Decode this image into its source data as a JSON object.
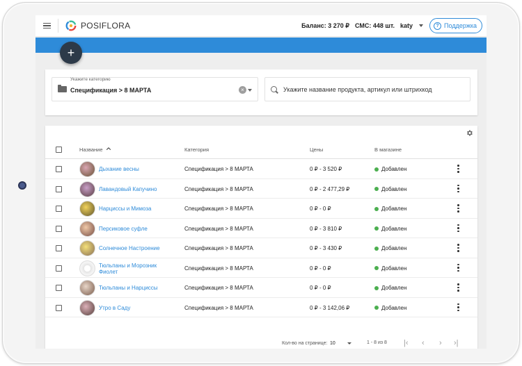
{
  "header": {
    "brand": "POSIFLORA",
    "balance": "Баланс: 3 270 ₽",
    "sms": "СМС: 448 шт.",
    "user": "katy",
    "support_label": "Поддержка"
  },
  "fab_label": "+",
  "filters": {
    "category_label": "Укажите категорию",
    "category_value": "Спецификация > 8 МАРТА",
    "search_placeholder": "Укажите название продукта, артикул или штрихкод"
  },
  "table": {
    "columns": {
      "name": "Название",
      "category": "Категория",
      "price": "Цены",
      "status": "В магазине"
    },
    "rows": [
      {
        "name": "Дыхание весны",
        "category": "Спецификация > 8 МАРТА",
        "price": "0 ₽ - 3 520 ₽",
        "status": "Добавлен"
      },
      {
        "name": "Лавандовый Капучино",
        "category": "Спецификация > 8 МАРТА",
        "price": "0 ₽ - 2 477,29 ₽",
        "status": "Добавлен"
      },
      {
        "name": "Нарциссы и Мимоза",
        "category": "Спецификация > 8 МАРТА",
        "price": "0 ₽ - 0 ₽",
        "status": "Добавлен"
      },
      {
        "name": "Персиковое суфле",
        "category": "Спецификация > 8 МАРТА",
        "price": "0 ₽ - 3 810 ₽",
        "status": "Добавлен"
      },
      {
        "name": "Солнечное Настроение",
        "category": "Спецификация > 8 МАРТА",
        "price": "0 ₽ - 3 430 ₽",
        "status": "Добавлен"
      },
      {
        "name": "Тюльпаны и Морозник Фиолет",
        "category": "Спецификация > 8 МАРТА",
        "price": "0 ₽ - 0 ₽",
        "status": "Добавлен"
      },
      {
        "name": "Тюльпаны и Нарциссы",
        "category": "Спецификация > 8 МАРТА",
        "price": "0 ₽ - 0 ₽",
        "status": "Добавлен"
      },
      {
        "name": "Утро в Саду",
        "category": "Спецификация > 8 МАРТА",
        "price": "0 ₽ - 3 142,06 ₽",
        "status": "Добавлен"
      }
    ]
  },
  "pagination": {
    "per_page_label": "Кол-во на странице:",
    "per_page_value": "10",
    "range": "1 - 8 из 8",
    "first": "|‹",
    "prev": "‹",
    "next": "›",
    "last": "›|"
  },
  "colors": {
    "accent": "#2e8bd9",
    "fab": "#2d3a49",
    "status_ok": "#4caf50"
  },
  "icons": [
    "menu-icon",
    "logo-icon",
    "help-icon",
    "folder-icon",
    "clear-icon",
    "search-icon",
    "gear-icon",
    "sort-asc-icon",
    "more-vert-icon"
  ]
}
